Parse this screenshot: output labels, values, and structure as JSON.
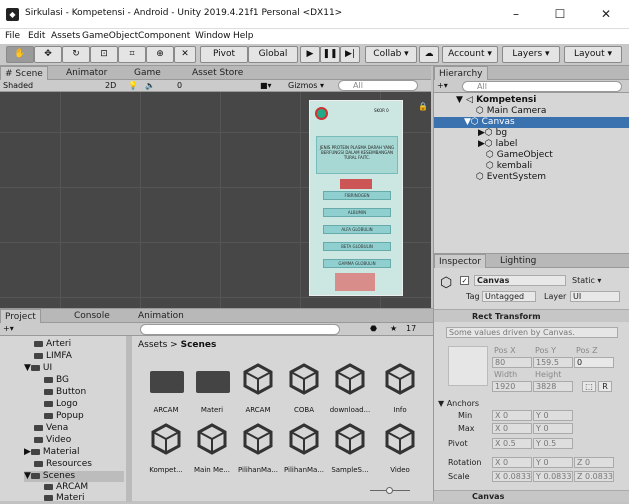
{
  "window": {
    "title": "Sirkulasi - Kompetensi - Android - Unity 2019.4.21f1 Personal <DX11>",
    "minimize": "–",
    "maximize": "☐",
    "close": "✕"
  },
  "menu": [
    "File",
    "Edit",
    "Assets",
    "GameObject",
    "Component",
    "Window",
    "Help"
  ],
  "toolbar": {
    "pivot": "Pivot",
    "global": "Global",
    "collab": "Collab ▾",
    "account": "Account ▾",
    "layers": "Layers ▾",
    "layout": "Layout ▾"
  },
  "scene_tabs": [
    "# Scene",
    "Animator",
    "Game",
    "Asset Store"
  ],
  "scene_bar": {
    "shading": "Shaded",
    "mode_2d": "2D",
    "gizmos": "Gizmos ▾",
    "search_placeholder": "All",
    "counter": "0"
  },
  "phone": {
    "score": "SKOR 0",
    "question": "JENIS PROTEIN PLASMA DARAH YANG BERFUNGSI DALAM KESEIMBANGAN TURAL FAITC.",
    "options": [
      "FIBRINOGEN",
      "ALBUMIN",
      "ALFA GLOBULIN",
      "BETA GLOBULIN",
      "GAMMA GLOBULIN"
    ]
  },
  "hierarchy": {
    "tab": "Hierarchy",
    "search_placeholder": "All",
    "items": [
      "Kompetensi",
      "Main Camera",
      "Canvas",
      "bg",
      "label",
      "GameObject",
      "kembali",
      "EventSystem"
    ]
  },
  "inspector": {
    "tabs": [
      "Inspector",
      "Lighting"
    ],
    "object_name": "Canvas",
    "static_label": "Static ▾",
    "tag_label": "Tag",
    "tag_value": "Untagged",
    "layer_label": "Layer",
    "layer_value": "UI",
    "component": "Rect Transform",
    "driven_note": "Some values driven by Canvas.",
    "posx_label": "Pos X",
    "posy_label": "Pos Y",
    "posz_label": "Pos Z",
    "posx": "80",
    "posy": "159.5",
    "posz": "0",
    "width_label": "Width",
    "height_label": "Height",
    "width": "1920",
    "height": "3828",
    "r_button": "R",
    "anchors": "Anchors",
    "min": "Min",
    "max": "Max",
    "pivot": "Pivot",
    "rotation": "Rotation",
    "scale": "Scale",
    "min_x": "0",
    "min_y": "0",
    "max_x": "0",
    "max_y": "0",
    "pivot_x": "0.5",
    "pivot_y": "0.5",
    "rot_x": "0",
    "rot_y": "0",
    "rot_z": "0",
    "scale_x": "0.0833",
    "scale_y": "0.0833",
    "scale_z": "0.0833",
    "next_component": "Canvas"
  },
  "project": {
    "tabs": [
      "Project",
      "Console",
      "Animation"
    ],
    "search_placeholder": "",
    "hidden_count": "17",
    "breadcrumb_root": "Assets",
    "breadcrumb_sep": ">",
    "breadcrumb_leaf": "Scenes",
    "tree": [
      "Arteri",
      "LIMFA",
      "UI",
      "BG",
      "Button",
      "Logo",
      "Popup",
      "Vena",
      "Video",
      "Material",
      "Resources",
      "Scenes",
      "ARCAM",
      "Materi"
    ],
    "assets": [
      "ARCAM",
      "Materi",
      "ARCAM",
      "COBA",
      "download...",
      "Info",
      "Kompet...",
      "Main Me...",
      "PilihanMa...",
      "PilihanMa...",
      "SampleS...",
      "Video"
    ]
  }
}
